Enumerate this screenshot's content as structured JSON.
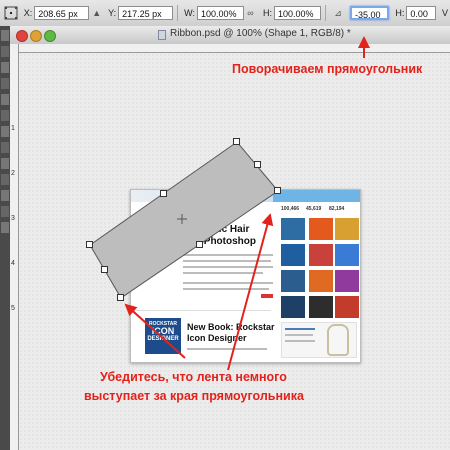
{
  "options_bar": {
    "x_label": "X:",
    "x_value": "208.65 px",
    "y_label": "Y:",
    "y_value": "217.25 px",
    "w_label": "W:",
    "w_value": "100.00%",
    "h_label": "H:",
    "h_value": "100.00%",
    "angle_value": "-35.00",
    "h_skew_label": "H:",
    "h_skew_value": "0.00",
    "v_label": "V"
  },
  "document": {
    "title": "Ribbon.psd @ 100% (Shape 1, RGB/8) *"
  },
  "ruler_left": [
    "1",
    "2",
    "3",
    "4",
    "5"
  ],
  "annotations": {
    "top": "Поворачиваем прямоугольник",
    "bottom_line1": "Убедитесь, что лента немного",
    "bottom_line2": "выступает за края прямоугольника"
  },
  "preview": {
    "stats": [
      "100,466",
      "45,619",
      "82,194"
    ],
    "headline1": "Realistic Hair",
    "headline2": "ing Photoshop",
    "book_title1": "New Book: Rockstar",
    "book_title2": "Icon Designer",
    "badge_line1": "ROCKSTAR",
    "badge_line2": "ICON",
    "badge_line3": "DESIGNER"
  },
  "colors": {
    "annotation": "#e3221b",
    "shape_fill": "#bdbdbd",
    "active_field": "#7aa8ef"
  }
}
